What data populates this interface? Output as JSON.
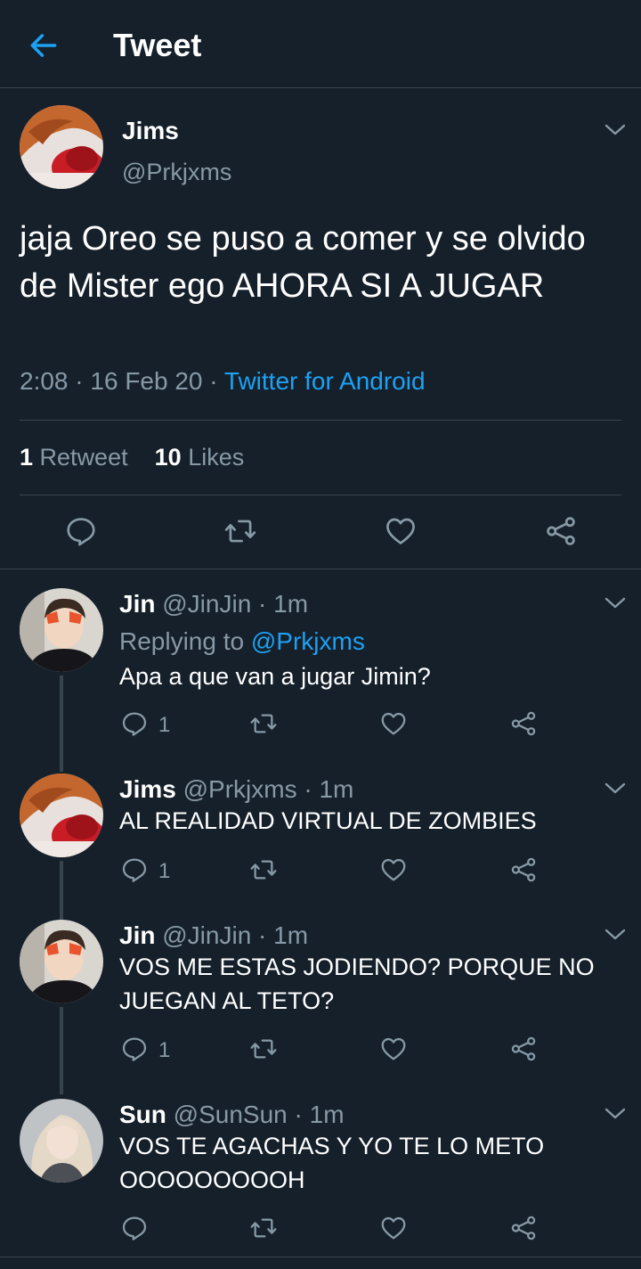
{
  "header": {
    "title": "Tweet",
    "back_icon": "arrow-left-icon",
    "accent": "#1da1f2"
  },
  "main_tweet": {
    "name": "Jims",
    "handle": "@Prkjxms",
    "text": "jaja Oreo se puso a comer y se olvido de Mister ego AHORA SI A JUGAR",
    "time": "2:08",
    "date": "16 Feb 20",
    "source": "Twitter for Android",
    "retweets_count": "1",
    "retweets_label": "Retweet",
    "likes_count": "10",
    "likes_label": "Likes"
  },
  "replies": [
    {
      "name": "Jin",
      "handle": "@JinJin",
      "time": "1m",
      "replying_label": "Replying to",
      "replying_to": "@Prkjxms",
      "text": "Apa a que van a jugar Jimin?",
      "reply_count": "1"
    },
    {
      "name": "Jims",
      "handle": "@Prkjxms",
      "time": "1m",
      "text": "AL REALIDAD VIRTUAL DE ZOMBIES",
      "reply_count": "1"
    },
    {
      "name": "Jin",
      "handle": "@JinJin",
      "time": "1m",
      "text": "VOS ME ESTAS JODIENDO? PORQUE NO JUEGAN AL TETO?",
      "reply_count": "1"
    },
    {
      "name": "Sun",
      "handle": "@SunSun",
      "time": "1m",
      "text": "VOS TE AGACHAS Y YO TE LO METO OOOOOOOOOH",
      "reply_count": ""
    }
  ],
  "colors": {
    "background": "#15202b",
    "divider": "#38444d",
    "secondary_text": "#8899a6",
    "link": "#1da1f2"
  },
  "separator": "·"
}
